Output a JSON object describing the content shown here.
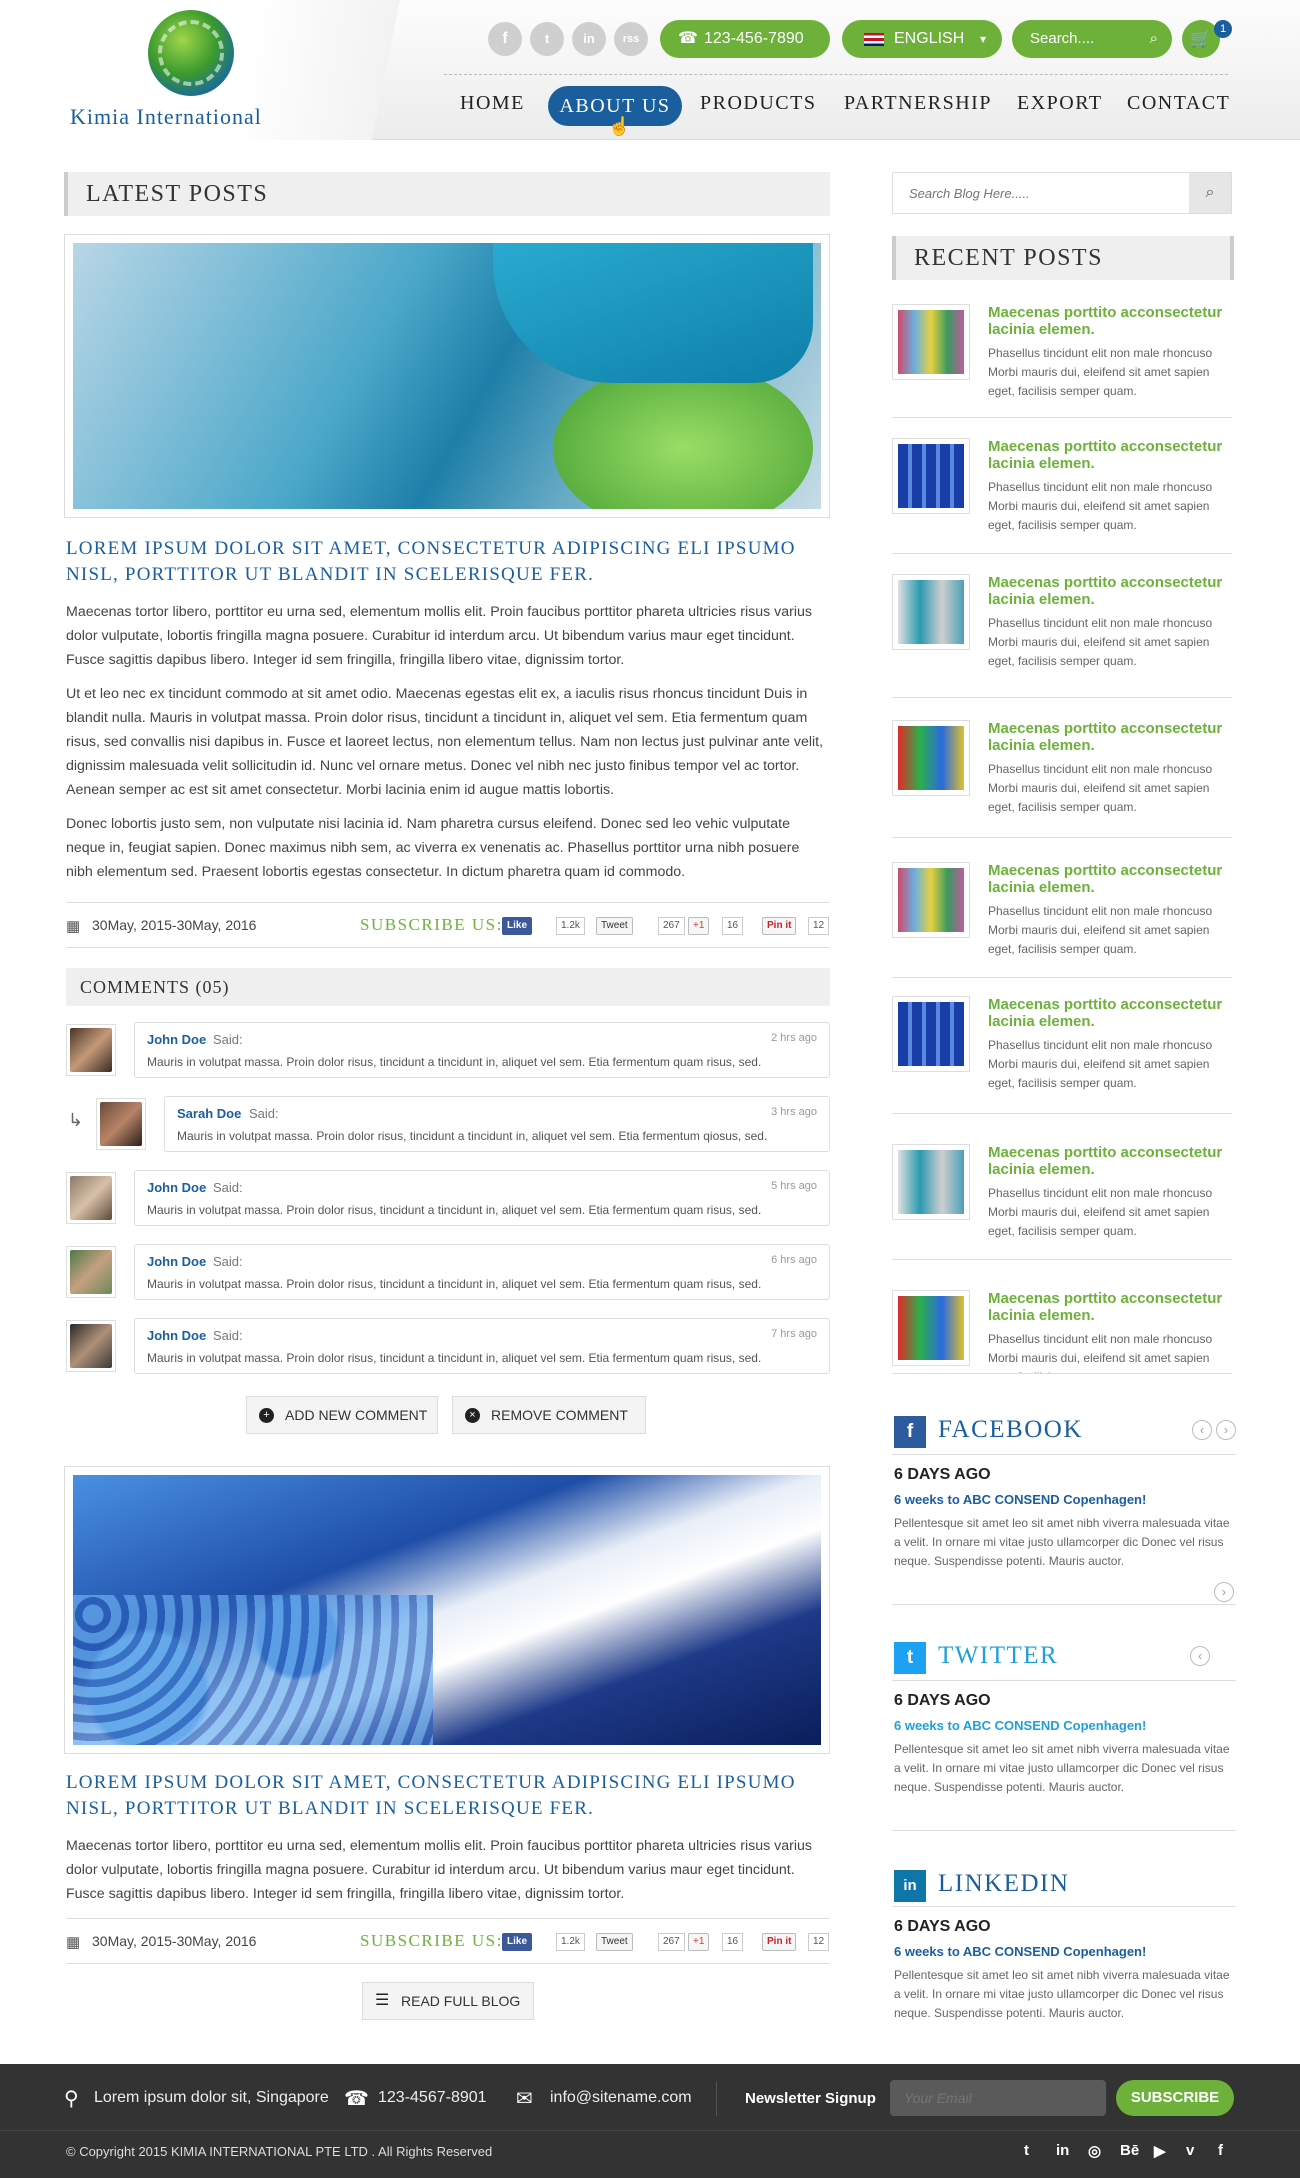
{
  "brand": {
    "name": "Kimia International"
  },
  "header": {
    "social": [
      "f",
      "t",
      "in",
      "rss"
    ],
    "phone": "123-456-7890",
    "language": "ENGLISH",
    "search_placeholder": "Search....",
    "cart_count": "1"
  },
  "nav": [
    "HOME",
    "ABOUT US",
    "PRODUCTS",
    "PARTNERSHIP",
    "EXPORT",
    "CONTACT"
  ],
  "main": {
    "latest_title": "LATEST POSTS",
    "posts": [
      {
        "title": "Lorem ipsum dolor sit amet, consectetur adipiscing eli  ipsumo nisl, porttitor ut blandit in scelerisque fer.",
        "paragraphs": [
          "Maecenas tortor libero, porttitor eu urna sed, elementum mollis elit. Proin faucibus porttitor phareta ultricies risus varius dolor vulputate, lobortis fringilla magna posuere. Curabitur id interdum arcu. Ut bibendum varius maur eget tincidunt. Fusce sagittis dapibus libero. Integer id sem fringilla, fringilla libero vitae, dignissim tortor.",
          "Ut et leo nec ex tincidunt commodo at sit amet odio. Maecenas egestas elit ex, a iaculis risus rhoncus tincidunt Duis in blandit nulla. Mauris in volutpat massa. Proin dolor risus, tincidunt a tincidunt in, aliquet vel sem. Etia fermentum quam risus, sed convallis nisi dapibus in. Fusce et laoreet lectus, non elementum tellus. Nam non lectus just pulvinar ante velit, dignissim malesuada velit sollicitudin id. Nunc vel ornare metus. Donec vel nibh nec justo finibus tempor vel ac tortor. Aenean semper ac est sit amet consectetur. Morbi lacinia enim id augue mattis lobortis.",
          "Donec lobortis justo sem, non vulputate nisi lacinia id. Nam pharetra cursus eleifend. Donec sed leo vehic vulputate neque in, feugiat sapien. Donec maximus nibh sem, ac viverra ex venenatis ac. Phasellus porttitor urna nibh posuere nibh elementum sed. Praesent lobortis egestas consectetur. In dictum pharetra quam id commodo."
        ],
        "date": "30May, 2015-30May, 2016"
      },
      {
        "title": "Lorem ipsum dolor sit amet, consectetur adipiscing eli  ipsumo nisl, porttitor ut blandit in scelerisque fer.",
        "paragraphs": [
          "Maecenas tortor libero, porttitor eu urna sed, elementum mollis elit. Proin faucibus porttitor phareta ultricies risus varius dolor vulputate, lobortis fringilla magna posuere. Curabitur id interdum arcu. Ut bibendum varius maur eget tincidunt. Fusce sagittis dapibus libero. Integer id sem fringilla, fringilla libero vitae, dignissim tortor."
        ],
        "date": "30May, 2015-30May, 2016"
      }
    ],
    "subscribe_label": "SUBSCRIBE US:",
    "share": {
      "fb": "Like",
      "fb_count": "1.2k",
      "tw": "Tweet",
      "tw_count": "267",
      "gp": "+1",
      "gp_count": "16",
      "pin": "Pin it",
      "pin_count": "12"
    },
    "comments_title": "COMMENTS (05)",
    "said": "Said:",
    "comments": [
      {
        "name": "John Doe",
        "time": "2 hrs ago",
        "text": "Mauris in volutpat massa. Proin dolor risus, tincidunt a tincidunt in, aliquet vel sem. Etia fermentum quam risus, sed."
      },
      {
        "name": "Sarah Doe",
        "time": "3 hrs ago",
        "text": "Mauris in volutpat massa. Proin dolor risus, tincidunt a tincidunt in, aliquet vel sem. Etia fermentum qiosus, sed."
      },
      {
        "name": "John Doe",
        "time": "5 hrs ago",
        "text": "Mauris in volutpat massa. Proin dolor risus, tincidunt a tincidunt in, aliquet vel sem. Etia fermentum quam risus, sed."
      },
      {
        "name": "John Doe",
        "time": "6 hrs ago",
        "text": "Mauris in volutpat massa. Proin dolor risus, tincidunt a tincidunt in, aliquet vel sem. Etia fermentum quam risus, sed."
      },
      {
        "name": "John Doe",
        "time": "7 hrs ago",
        "text": "Mauris in volutpat massa. Proin dolor risus, tincidunt a tincidunt in, aliquet vel sem. Etia fermentum quam risus, sed."
      }
    ],
    "add_comment": "ADD NEW COMMENT",
    "remove_comment": "REMOVE COMMENT",
    "read_full": "READ FULL BLOG"
  },
  "sidebar": {
    "search_placeholder": "Search Blog Here.....",
    "recent_title": "RECENT POSTS",
    "recent_posts": [
      {
        "title": "Maecenas porttito acconsectetur lacinia elemen.",
        "text": "Phasellus tincidunt elit non male rhoncuso Morbi mauris dui, eleifend sit amet sapien eget, facilisis semper quam."
      },
      {
        "title": "Maecenas porttito acconsectetur lacinia elemen.",
        "text": "Phasellus tincidunt elit non male rhoncuso Morbi mauris dui, eleifend sit amet sapien eget, facilisis semper quam."
      },
      {
        "title": "Maecenas porttito acconsectetur lacinia elemen.",
        "text": "Phasellus tincidunt elit non male rhoncuso Morbi mauris dui, eleifend sit amet sapien eget, facilisis semper quam."
      },
      {
        "title": "Maecenas porttito acconsectetur lacinia elemen.",
        "text": "Phasellus tincidunt elit non male rhoncuso Morbi mauris dui, eleifend sit amet sapien eget, facilisis semper quam."
      },
      {
        "title": "Maecenas porttito acconsectetur lacinia elemen.",
        "text": "Phasellus tincidunt elit non male rhoncuso Morbi mauris dui, eleifend sit amet sapien eget, facilisis semper quam."
      },
      {
        "title": "Maecenas porttito acconsectetur lacinia elemen.",
        "text": "Phasellus tincidunt elit non male rhoncuso Morbi mauris dui, eleifend sit amet sapien eget, facilisis semper quam."
      },
      {
        "title": "Maecenas porttito acconsectetur lacinia elemen.",
        "text": "Phasellus tincidunt elit non male rhoncuso Morbi mauris dui, eleifend sit amet sapien eget, facilisis semper quam."
      },
      {
        "title": "Maecenas porttito acconsectetur lacinia elemen.",
        "text": "Phasellus tincidunt elit non male rhoncuso Morbi mauris dui, eleifend sit amet sapien eget, facilisis semper quam."
      }
    ],
    "facebook": {
      "title": "FACEBOOK",
      "date": "6 DAYS AGO",
      "link": "6 weeks to ABC CONSEND Copenhagen!",
      "text": "Pellentesque sit amet leo sit amet nibh viverra malesuada vitae a velit. In ornare mi vitae justo ullamcorper dic Donec vel risus neque. Suspendisse potenti. Mauris auctor."
    },
    "twitter": {
      "title": "TWITTER",
      "date": "6 DAYS AGO",
      "link": "6 weeks to ABC CONSEND Copenhagen!",
      "text": "Pellentesque sit amet leo sit amet nibh viverra malesuada vitae a velit. In ornare mi vitae justo ullamcorper dic Donec vel risus neque. Suspendisse potenti. Mauris auctor."
    },
    "linkedin": {
      "title": "LINKEDIN",
      "date": "6 DAYS AGO",
      "link": "6 weeks to ABC CONSEND Copenhagen!",
      "text": "Pellentesque sit amet leo sit amet nibh viverra malesuada vitae a velit. In ornare mi vitae justo ullamcorper dic Donec vel risus neque. Suspendisse potenti. Mauris auctor."
    }
  },
  "footer": {
    "address": "Lorem ipsum dolor sit, Singapore",
    "phone": "123-4567-8901",
    "email": "info@sitename.com",
    "newsletter_label": "Newsletter Signup",
    "email_placeholder": "Your Email",
    "subscribe": "SUBSCRIBE",
    "copyright": "© Copyright 2015 KIMIA INTERNATIONAL PTE LTD . All Rights Reserved",
    "social": [
      "t",
      "in",
      "◎",
      "Bē",
      "▶",
      "v",
      "f"
    ]
  },
  "colors": {
    "accent_green": "#6db13b",
    "brand_blue": "#1b5e9e",
    "footer_bg": "#333333"
  }
}
